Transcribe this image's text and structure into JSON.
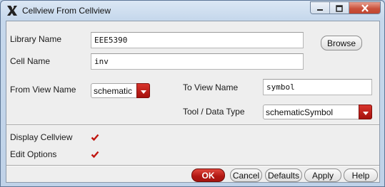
{
  "window": {
    "title": "Cellview From Cellview",
    "icons": [
      "app-x-icon",
      "minimize-icon",
      "maximize-icon",
      "close-icon"
    ]
  },
  "form": {
    "library_name_label": "Library Name",
    "library_name_value": "EEE5390",
    "browse_label": "Browse",
    "cell_name_label": "Cell Name",
    "cell_name_value": "inv",
    "from_view_label": "From View Name",
    "from_view_value": "schematic",
    "to_view_label": "To View Name",
    "to_view_value": "symbol",
    "tool_label": "Tool / Data Type",
    "tool_value": "schematicSymbol",
    "display_cellview_label": "Display Cellview",
    "display_cellview_checked": true,
    "edit_options_label": "Edit Options",
    "edit_options_checked": true
  },
  "buttons": {
    "ok": "OK",
    "cancel": "Cancel",
    "defaults": "Defaults",
    "apply": "Apply",
    "help": "Help"
  },
  "colors": {
    "accent_red": "#b11712",
    "window_frame": "#c6d8ec",
    "client_bg": "#eeeeee"
  }
}
